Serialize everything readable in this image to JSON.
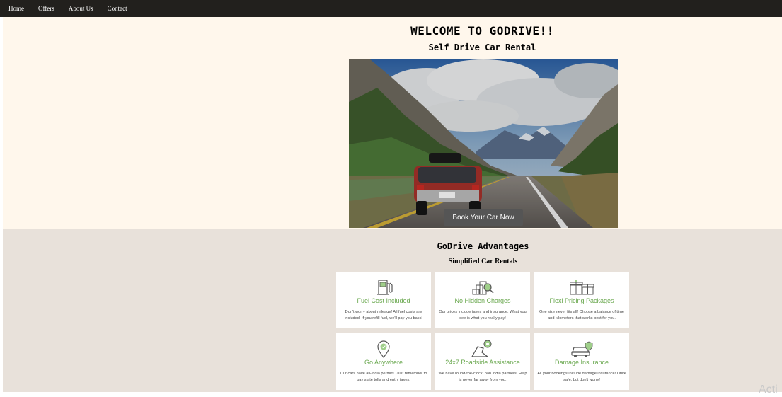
{
  "nav": {
    "items": [
      "Home",
      "Offers",
      "About Us",
      "Contact"
    ]
  },
  "hero": {
    "title": "WELCOME TO GODRIVE!!",
    "subtitle": "Self Drive Car Rental",
    "book_button": "Book Your Car Now"
  },
  "advantages": {
    "title": "GoDrive Advantages",
    "subtitle": "Simplified Car Rentals",
    "cards": [
      {
        "icon": "fuel-pump-icon",
        "title": "Fuel Cost Included",
        "desc": "Don't worry about mileage! All fuel costs are included. If you refill fuel, we'll pay you back!"
      },
      {
        "icon": "coins-magnifier-icon",
        "title": "No Hidden Charges",
        "desc": "Our prices include taxes and insurance. What you see is what you really pay!"
      },
      {
        "icon": "gift-boxes-icon",
        "title": "Flexi Pricing Packages",
        "desc": "One size never fits all! Choose a balance of time and kilometers that works best for you."
      },
      {
        "icon": "location-pin-icon",
        "title": "Go Anywhere",
        "desc": "Our cars have all-India permits. Just remember to pay state tolls and entry taxes."
      },
      {
        "icon": "roadside-pin-icon",
        "title": "24x7 Roadside Assistance",
        "desc": "We have round-the-clock, pan India partners. Help is never far away from you."
      },
      {
        "icon": "car-shield-icon",
        "title": "Damage Insurance",
        "desc": "All your bookings include damage insurance! Drive safe, but don't worry!"
      }
    ]
  },
  "watermark": "Acti",
  "colors": {
    "nav_bg": "#22201d",
    "hero_bg": "#fff7ec",
    "adv_bg": "#e8e1da",
    "accent_green": "#6aa84f",
    "button_bg": "#555555"
  }
}
